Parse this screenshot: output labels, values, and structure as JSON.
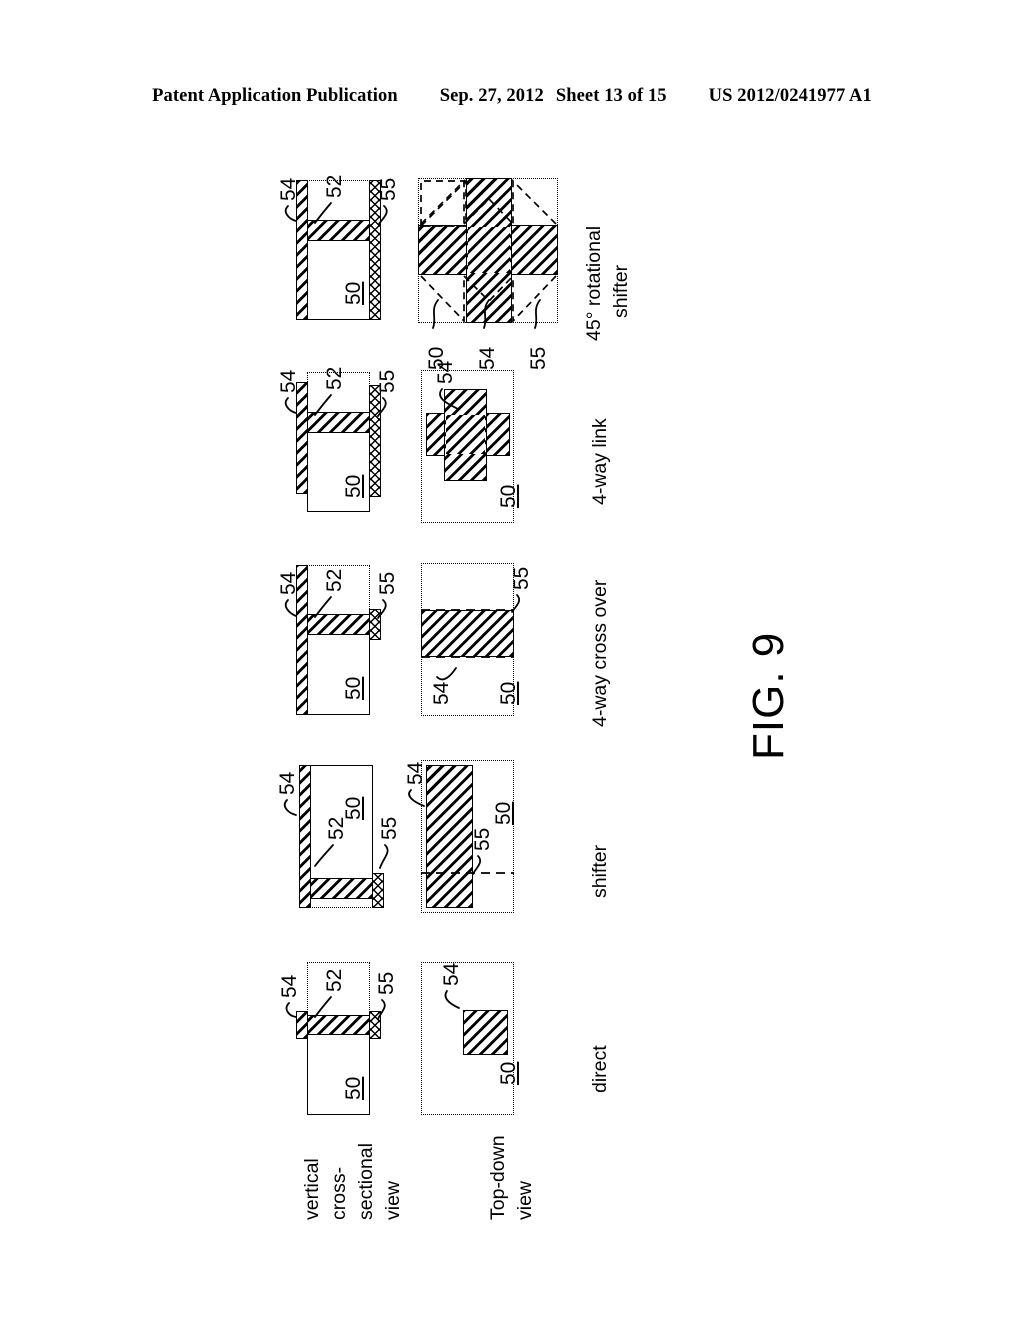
{
  "header": {
    "publication": "Patent Application Publication",
    "date": "Sep. 27, 2012",
    "sheet": "Sheet 13 of 15",
    "number": "US 2012/0241977 A1"
  },
  "figure": {
    "label": "FIG. 9",
    "row_labels": {
      "cross_section": "vertical cross- sectional view",
      "cross_section_lines": [
        "vertical",
        "cross-",
        "sectional",
        "view"
      ],
      "top_down": "Top-down view",
      "top_down_lines": [
        "Top-down",
        "view"
      ]
    },
    "columns": [
      {
        "id": "direct",
        "label": "direct"
      },
      {
        "id": "shifter",
        "label": "shifter"
      },
      {
        "id": "crossover",
        "label": "4-way cross over"
      },
      {
        "id": "link",
        "label": "4-way link"
      },
      {
        "id": "rotational",
        "label": "45° rotational shifter",
        "label_lines": [
          "45° rotational",
          "shifter"
        ]
      }
    ],
    "reference_numerals": {
      "substrate": "50",
      "upper_layer": "52",
      "conductive_layer": "54",
      "sidewall": "55"
    },
    "callouts": {
      "direct": {
        "cross_section": [
          "54",
          "52",
          "55",
          "50"
        ],
        "top_down": [
          "54",
          "50"
        ]
      },
      "shifter": {
        "cross_section": [
          "54",
          "52",
          "55",
          "50"
        ],
        "top_down": [
          "54",
          "50",
          "55"
        ]
      },
      "crossover": {
        "cross_section": [
          "54",
          "52",
          "55",
          "50"
        ],
        "top_down": [
          "54",
          "50",
          "55"
        ]
      },
      "link": {
        "cross_section": [
          "54",
          "52",
          "55",
          "50"
        ],
        "top_down": [
          "54",
          "50"
        ]
      },
      "rotational": {
        "cross_section": [
          "54",
          "52",
          "55",
          "50"
        ],
        "top_down": [
          "50",
          "54",
          "55"
        ]
      }
    },
    "colors": {
      "ink": "#000000",
      "paper": "#ffffff"
    }
  }
}
